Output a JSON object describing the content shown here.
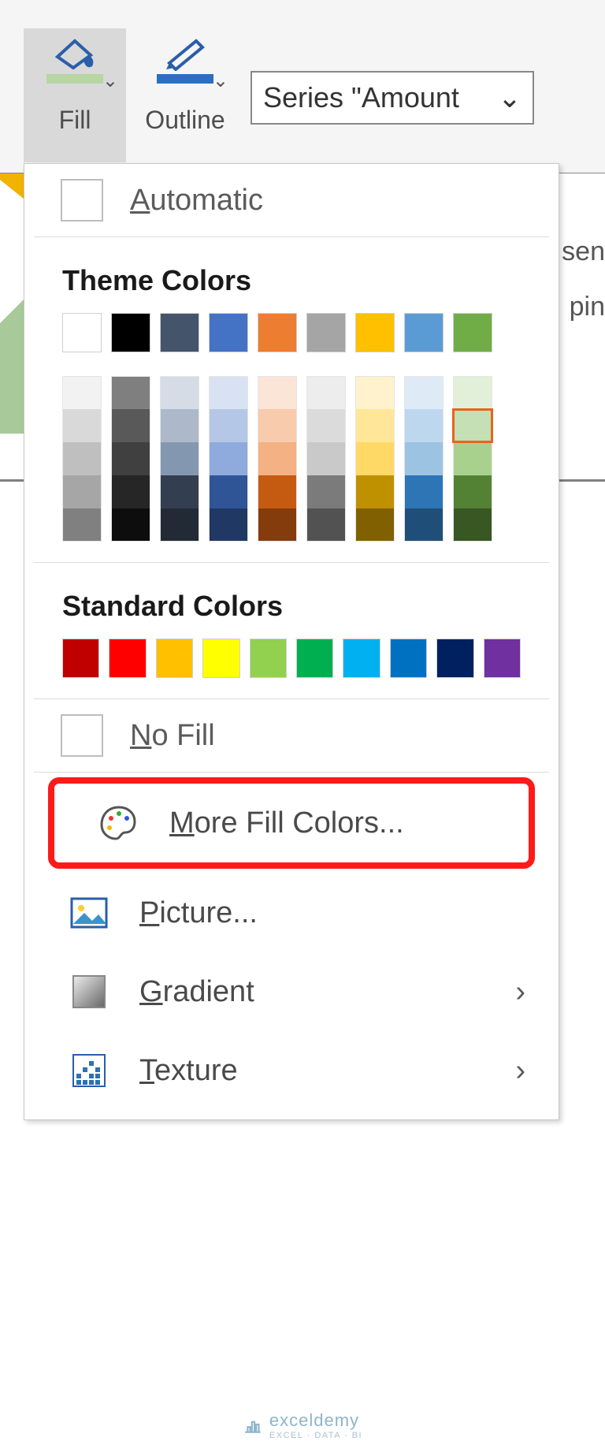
{
  "ribbon": {
    "fill_label": "Fill",
    "outline_label": "Outline",
    "series_display": "Series \"Amount"
  },
  "background_text": {
    "line1": "sen",
    "line2": "pin"
  },
  "menu": {
    "automatic": "utomatic",
    "automatic_hotkey": "A",
    "theme_title": "Theme Colors",
    "standard_title": "Standard Colors",
    "no_fill": "o Fill",
    "no_fill_hotkey": "N",
    "more_colors": "ore Fill Colors...",
    "more_colors_hotkey": "M",
    "picture": "icture...",
    "picture_hotkey": "P",
    "gradient": "radient",
    "gradient_hotkey": "G",
    "texture": "exture",
    "texture_hotkey": "T"
  },
  "theme_colors": [
    "#ffffff",
    "#000000",
    "#44546a",
    "#4472c4",
    "#ed7d31",
    "#a5a5a5",
    "#ffc000",
    "#5b9bd5",
    "#70ad47"
  ],
  "theme_tints": [
    [
      "#f2f2f2",
      "#d9d9d9",
      "#bfbfbf",
      "#a6a6a6",
      "#808080"
    ],
    [
      "#7f7f7f",
      "#595959",
      "#404040",
      "#262626",
      "#0d0d0d"
    ],
    [
      "#d6dce5",
      "#adb9ca",
      "#8497b0",
      "#333f50",
      "#222a35"
    ],
    [
      "#d9e2f3",
      "#b4c7e7",
      "#8faadc",
      "#2f5597",
      "#1f3864"
    ],
    [
      "#fbe5d6",
      "#f8cbad",
      "#f4b183",
      "#c55a11",
      "#843c0c"
    ],
    [
      "#ededed",
      "#dbdbdb",
      "#c9c9c9",
      "#7b7b7b",
      "#525252"
    ],
    [
      "#fff2cc",
      "#ffe699",
      "#ffd966",
      "#bf9000",
      "#806000"
    ],
    [
      "#deebf7",
      "#bdd7ee",
      "#9dc3e2",
      "#2e75b6",
      "#1f4e79"
    ],
    [
      "#e2f0d9",
      "#c5e0b4",
      "#a9d18e",
      "#548235",
      "#385723"
    ]
  ],
  "selected_tint": {
    "col": 8,
    "row": 1
  },
  "standard_colors": [
    "#c00000",
    "#ff0000",
    "#ffc000",
    "#ffff00",
    "#92d050",
    "#00b050",
    "#00b0f0",
    "#0070c0",
    "#002060",
    "#7030a0"
  ],
  "watermark": {
    "brand": "exceldemy",
    "tagline": "EXCEL · DATA · BI"
  }
}
